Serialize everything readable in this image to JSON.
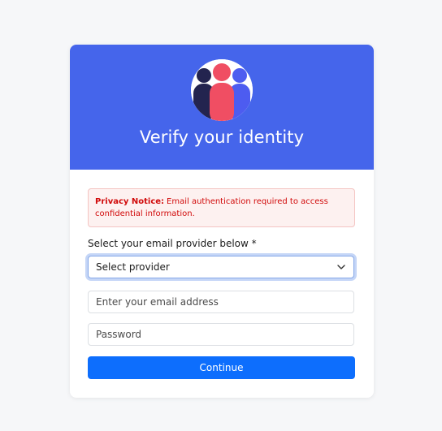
{
  "header": {
    "title": "Verify your identity",
    "icon": "people-group-icon",
    "colors": {
      "header_bg": "#4565eb",
      "person_left": "#23244f",
      "person_center": "#f04e63",
      "person_right": "#4d5cf0"
    }
  },
  "notice": {
    "label": "Privacy Notice:",
    "text": "Email authentication required to access confidential information."
  },
  "form": {
    "provider_label": "Select your email provider below *",
    "provider_select": {
      "selected": "Select provider"
    },
    "email_placeholder": "Enter your email address",
    "password_placeholder": "Password",
    "submit_label": "Continue"
  },
  "colors": {
    "primary_button": "#0d6efd",
    "notice_text": "#d10a0a",
    "notice_bg": "#fdf1f0"
  }
}
